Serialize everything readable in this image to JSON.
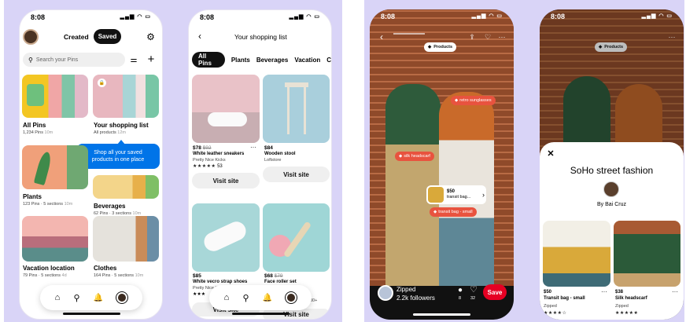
{
  "status_time": "8:08",
  "profile": {
    "tab_created": "Created",
    "tab_saved": "Saved",
    "search_placeholder": "Search your Pins",
    "boards": [
      {
        "name": "All Pins",
        "meta": "1,234 Pins",
        "time": "10m"
      },
      {
        "name": "Your shopping list",
        "meta": "All products",
        "time": "12m"
      },
      {
        "name": "Plants",
        "meta": "123 Pins · 5 sections",
        "time": "10m"
      },
      {
        "name": "Beverages",
        "meta": "62 Pins · 3 sections",
        "time": "10m"
      },
      {
        "name": "Vacation location",
        "meta": "79 Pins · 5 sections",
        "time": "4d"
      },
      {
        "name": "Clothes",
        "meta": "164 Pins · 5 sections",
        "time": "10m"
      }
    ],
    "tooltip": "Shop all your saved products in one place"
  },
  "shopping": {
    "title": "Your shopping list",
    "chips": [
      "All Pins",
      "Plants",
      "Beverages",
      "Vacation",
      "C"
    ],
    "products": [
      {
        "price": "$78",
        "old_price": "$92",
        "name": "White leather sneakers",
        "brand": "Pretty Nice Kicks",
        "stars": "★★★★★",
        "rating": "53",
        "cta": "Visit site"
      },
      {
        "price": "$84",
        "old_price": "",
        "name": "Wooden stool",
        "brand": "Loftstore",
        "stars": "",
        "rating": "",
        "cta": "Visit site"
      },
      {
        "price": "$85",
        "old_price": "",
        "name": "White vecro strap shoes",
        "brand": "Pretty Nice Kicks",
        "stars": "★★★",
        "rating": "",
        "cta": "Visit site"
      },
      {
        "price": "$68",
        "old_price": "$79",
        "name": "Face roller set",
        "brand": "",
        "stars": "",
        "rating": "30+",
        "cta": "Visit site"
      }
    ],
    "more": "···"
  },
  "pin": {
    "tags": {
      "products": "Products",
      "sunglasses": "retro sunglasses",
      "headscarf": "silk headscarf",
      "transit": "transit bag - small"
    },
    "card_price": "$50",
    "card_name": "transit bag...",
    "user": "Zipped",
    "followers": "2.2k followers",
    "comments": "8",
    "likes": "32",
    "save": "Save"
  },
  "sheet": {
    "products_tag": "Products",
    "title": "SoHo street fashion",
    "by": "By Bai Cruz",
    "items": [
      {
        "price": "$50",
        "name": "Transit bag - small",
        "brand": "Zipped",
        "stars": "★★★★☆"
      },
      {
        "price": "$38",
        "name": "Silk headscarf",
        "brand": "Zipped",
        "stars": "★★★★★"
      }
    ],
    "more": "···"
  },
  "colors": {
    "bg": "#d9d4f7",
    "red": "#e60023",
    "chip": "#111111",
    "brick": "#a0552f"
  }
}
